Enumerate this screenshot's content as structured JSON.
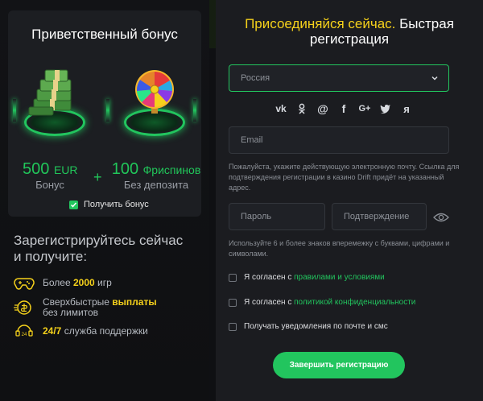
{
  "bonus": {
    "title": "Приветственный бонус",
    "cash_amount": "500",
    "cash_unit": "EUR",
    "cash_label": "Бонус",
    "plus": "+",
    "spins_amount": "100",
    "spins_unit": "Фриспинов",
    "spins_label": "Без депозита",
    "checkbox_label": "Получить бонус",
    "checkbox_checked": true
  },
  "promo": {
    "title_line1": "Зарегистрируйтесь сейчас",
    "title_line2": "и получите:",
    "features": [
      {
        "icon": "gamepad-icon",
        "prefix": "Более ",
        "highlight": "2000",
        "suffix": " игр",
        "line2": ""
      },
      {
        "icon": "payout-icon",
        "prefix": "Сверхбыстрые ",
        "highlight": "выплаты",
        "suffix": "",
        "line2": "без лимитов"
      },
      {
        "icon": "support-24-icon",
        "prefix": "",
        "highlight": "24/7",
        "suffix": " служба поддержки",
        "line2": ""
      }
    ]
  },
  "registration": {
    "title_highlight": "Присоединяйся сейчас.",
    "title_rest_1": " Быстрая",
    "title_rest_2": "регистрация",
    "country_value": "Россия",
    "socials": [
      "vk-icon",
      "ok-icon",
      "mail-at-icon",
      "facebook-icon",
      "google-plus-icon",
      "twitter-icon",
      "yandex-icon"
    ],
    "email_placeholder": "Email",
    "email_hint": "Пожалуйста, укажите действующую электронную почту. Ссылка для подтверждения регистрации в казино Drift придёт на указанный адрес.",
    "password_placeholder": "Пароль",
    "confirm_placeholder": "Подтверждение",
    "password_hint": "Используйте 6 и более знаков вперемежку с буквами, цифрами и символами.",
    "agree_rules_prefix": "Я согласен с ",
    "agree_rules_link": "правилами и условиями",
    "agree_privacy_prefix": "Я согласен с ",
    "agree_privacy_link": "политикой конфиденциальности",
    "newsletter_label": "Получать уведомления по почте и смс",
    "submit_label": "Завершить регистрацию"
  },
  "colors": {
    "accent_green": "#22c55e",
    "accent_yellow": "#f5d11b",
    "background": "#0f1013",
    "panel": "#1b1c20"
  }
}
